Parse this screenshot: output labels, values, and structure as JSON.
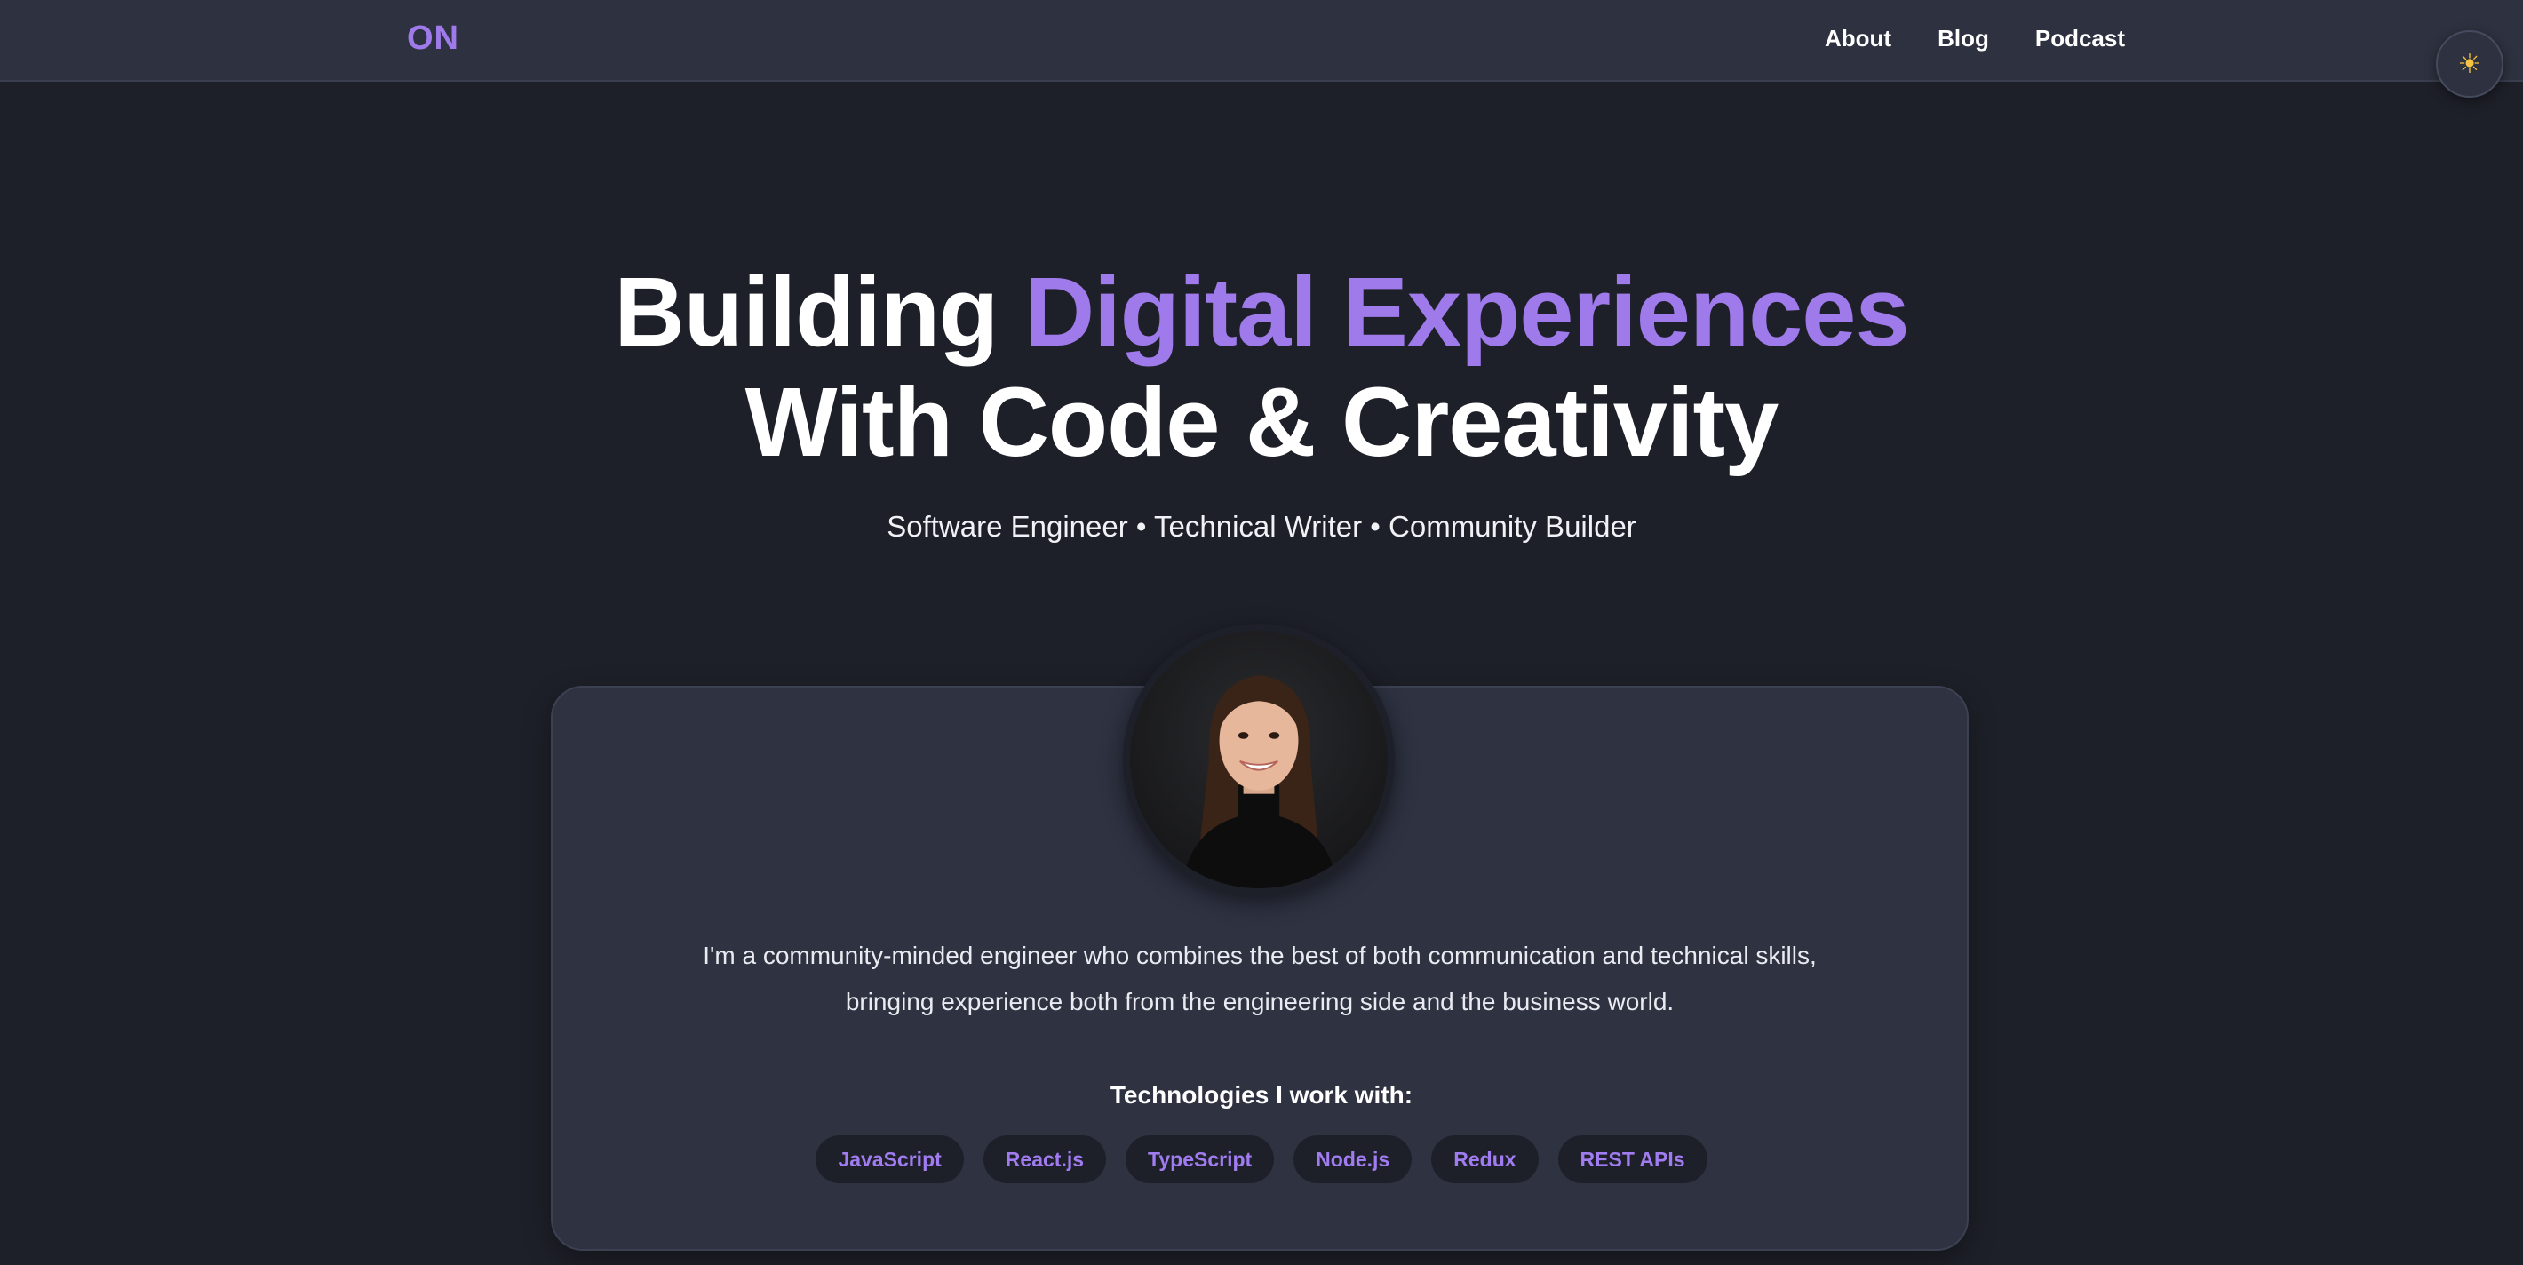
{
  "header": {
    "logo": "ON",
    "nav": [
      {
        "label": "About"
      },
      {
        "label": "Blog"
      },
      {
        "label": "Podcast"
      }
    ],
    "theme_toggle_icon": "sun-icon"
  },
  "hero": {
    "title_part1": "Building ",
    "title_accent": "Digital Experiences",
    "title_line2": "With Code & Creativity",
    "subtitle": "Software Engineer • Technical Writer • Community Builder"
  },
  "profile": {
    "bio": "I'm a community-minded engineer who combines the best of both communication and technical skills, bringing experience both from the engineering side and the business world.",
    "tech_heading": "Technologies I work with:",
    "technologies": [
      "JavaScript",
      "React.js",
      "TypeScript",
      "Node.js",
      "Redux",
      "REST APIs"
    ]
  },
  "colors": {
    "accent": "#9f7aea",
    "background": "#1e2029",
    "surface": "#2e3241"
  }
}
